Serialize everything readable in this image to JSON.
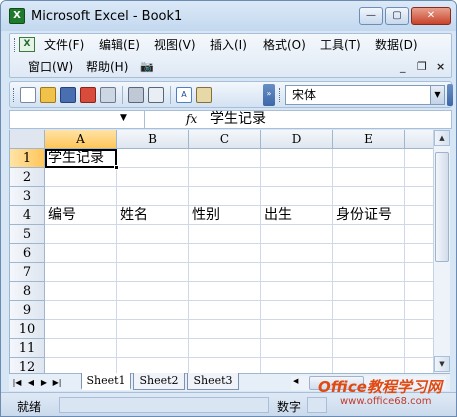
{
  "window": {
    "title": "Microsoft Excel - Book1",
    "app_icon": "excel-icon",
    "controls": {
      "minimize": "—",
      "maximize": "▢",
      "close": "✕"
    }
  },
  "menubar": {
    "items": [
      "文件(F)",
      "编辑(E)",
      "视图(V)",
      "插入(I)",
      "格式(O)",
      "工具(T)",
      "数据(D)",
      "窗口(W)",
      "帮助(H)"
    ],
    "doc_controls": {
      "minimize": "_",
      "restore": "❐",
      "close": "×"
    }
  },
  "toolbar": {
    "icons": [
      "new-document-icon",
      "open-folder-icon",
      "save-icon",
      "permission-icon",
      "email-icon",
      "print-icon",
      "print-preview-icon",
      "spelling-icon",
      "research-icon"
    ],
    "font_name": "宋体",
    "overflow": "»"
  },
  "formula_bar": {
    "name_box": "",
    "fx": "fx",
    "value": "学生记录"
  },
  "grid": {
    "columns": [
      "A",
      "B",
      "C",
      "D",
      "E"
    ],
    "rows": [
      "1",
      "2",
      "3",
      "4",
      "5",
      "6",
      "7",
      "8",
      "9",
      "10",
      "11",
      "12"
    ],
    "selected_cell": "A1",
    "cells": {
      "A1": "学生记录",
      "A4": "编号",
      "B4": "姓名",
      "C4": "性别",
      "D4": "出生",
      "E4": "身份证号"
    }
  },
  "sheets": {
    "tabs": [
      "Sheet1",
      "Sheet2",
      "Sheet3"
    ],
    "active": "Sheet1"
  },
  "statusbar": {
    "status": "就绪",
    "mode": "数字"
  },
  "watermark": {
    "title": "Office教程学习网",
    "url": "www.office68.com"
  }
}
